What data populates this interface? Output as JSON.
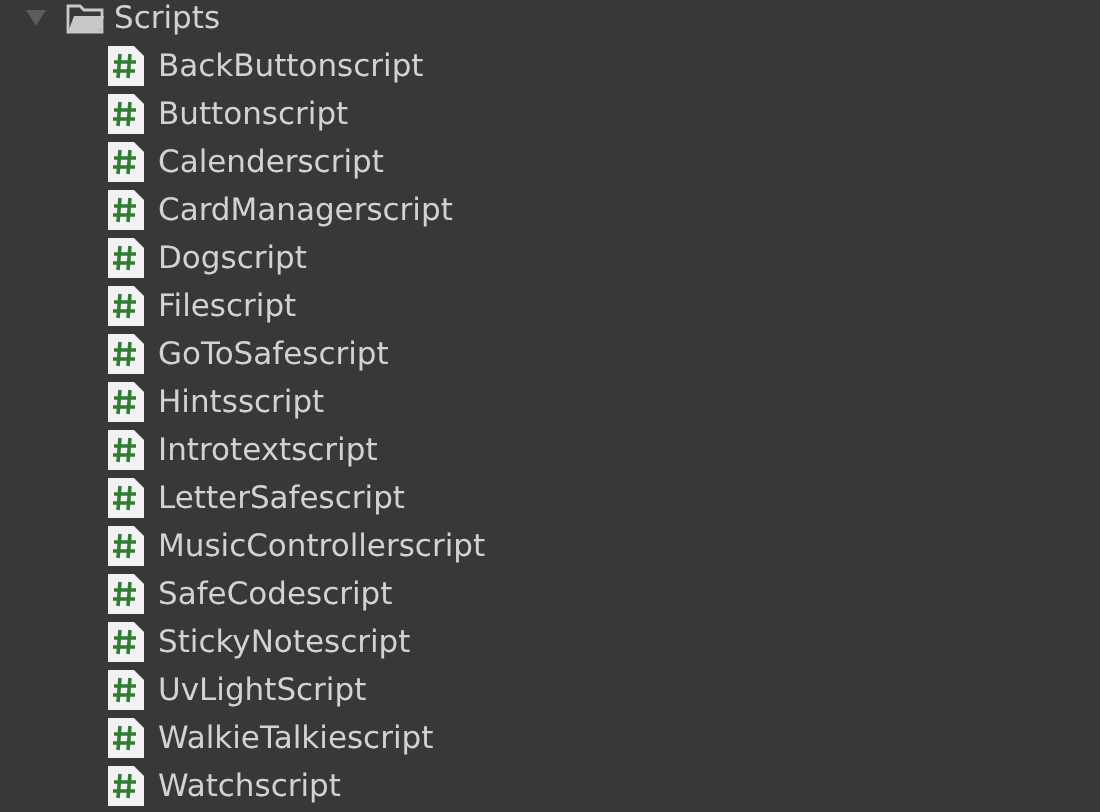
{
  "tree": {
    "label": "Scripts",
    "expanded": true,
    "children": [
      {
        "label": "BackButtonscript"
      },
      {
        "label": "Buttonscript"
      },
      {
        "label": "Calenderscript"
      },
      {
        "label": "CardManagerscript"
      },
      {
        "label": "Dogscript"
      },
      {
        "label": "Filescript"
      },
      {
        "label": "GoToSafescript"
      },
      {
        "label": "Hintsscript"
      },
      {
        "label": "Introtextscript"
      },
      {
        "label": "LetterSafescript"
      },
      {
        "label": "MusicControllerscript"
      },
      {
        "label": "SafeCodescript"
      },
      {
        "label": "StickyNotescript"
      },
      {
        "label": "UvLightScript"
      },
      {
        "label": "WalkieTalkiescript"
      },
      {
        "label": "Watchscript"
      }
    ]
  }
}
